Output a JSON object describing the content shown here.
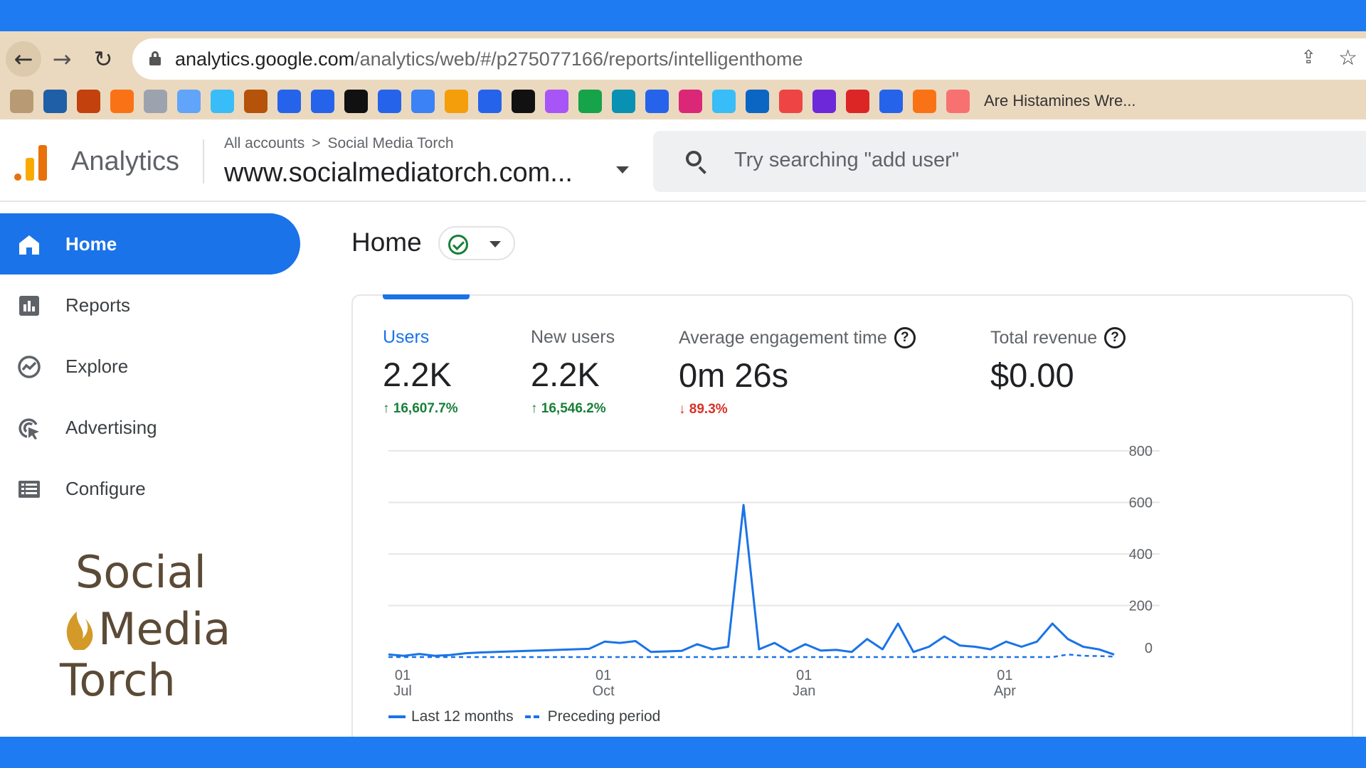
{
  "browser": {
    "url_host": "analytics.google.com",
    "url_path": "/analytics/web/#/p275077166/reports/intelligenthome",
    "bookmark_label": "Are Histamines Wre...",
    "bookmark_icons": [
      {
        "name": "bookmark-icon-1",
        "color": "#b89a74",
        "glyph": ""
      },
      {
        "name": "bookmark-icon-2",
        "color": "#1f5fa8",
        "glyph": ""
      },
      {
        "name": "bookmark-icon-3",
        "color": "#c2410c",
        "glyph": ""
      },
      {
        "name": "bookmark-icon-4",
        "color": "#f97316",
        "glyph": ""
      },
      {
        "name": "bookmark-icon-5",
        "color": "#9ca3af",
        "glyph": ""
      },
      {
        "name": "bookmark-icon-6",
        "color": "#60a5fa",
        "glyph": ""
      },
      {
        "name": "bookmark-icon-7",
        "color": "#38bdf8",
        "glyph": ""
      },
      {
        "name": "bookmark-icon-8",
        "color": "#b45309",
        "glyph": ""
      },
      {
        "name": "bookmark-icon-9",
        "color": "#2563eb",
        "glyph": ""
      },
      {
        "name": "bookmark-icon-10",
        "color": "#2563eb",
        "glyph": ""
      },
      {
        "name": "bookmark-icon-11",
        "color": "#111111",
        "glyph": ""
      },
      {
        "name": "bookmark-icon-12",
        "color": "#2563eb",
        "glyph": ""
      },
      {
        "name": "bookmark-icon-13",
        "color": "#3b82f6",
        "glyph": ""
      },
      {
        "name": "bookmark-icon-14",
        "color": "#f59e0b",
        "glyph": ""
      },
      {
        "name": "bookmark-icon-15",
        "color": "#2563eb",
        "glyph": ""
      },
      {
        "name": "bookmark-icon-16",
        "color": "#111111",
        "glyph": ""
      },
      {
        "name": "bookmark-icon-17",
        "color": "#a855f7",
        "glyph": ""
      },
      {
        "name": "bookmark-icon-18",
        "color": "#16a34a",
        "glyph": ""
      },
      {
        "name": "bookmark-icon-19",
        "color": "#0891b2",
        "glyph": ""
      },
      {
        "name": "bookmark-icon-20",
        "color": "#2563eb",
        "glyph": ""
      },
      {
        "name": "bookmark-icon-21",
        "color": "#db2777",
        "glyph": ""
      },
      {
        "name": "bookmark-icon-22",
        "color": "#38bdf8",
        "glyph": ""
      },
      {
        "name": "bookmark-icon-23",
        "color": "#0a66c2",
        "glyph": ""
      },
      {
        "name": "bookmark-icon-24",
        "color": "#ef4444",
        "glyph": ""
      },
      {
        "name": "bookmark-icon-25",
        "color": "#6d28d9",
        "glyph": ""
      },
      {
        "name": "bookmark-icon-26",
        "color": "#dc2626",
        "glyph": ""
      },
      {
        "name": "bookmark-icon-27",
        "color": "#2563eb",
        "glyph": ""
      },
      {
        "name": "bookmark-icon-28",
        "color": "#f97316",
        "glyph": ""
      },
      {
        "name": "bookmark-icon-29",
        "color": "#f87171",
        "glyph": ""
      }
    ]
  },
  "header": {
    "app_name": "Analytics",
    "breadcrumb_root": "All accounts",
    "breadcrumb_sep": ">",
    "breadcrumb_account": "Social Media Torch",
    "property": "www.socialmediatorch.com...",
    "search_placeholder": "Try searching \"add user\""
  },
  "sidebar": {
    "items": [
      {
        "label": "Home",
        "icon": "home-icon",
        "active": true
      },
      {
        "label": "Reports",
        "icon": "reports-icon",
        "active": false
      },
      {
        "label": "Explore",
        "icon": "explore-icon",
        "active": false
      },
      {
        "label": "Advertising",
        "icon": "advertising-icon",
        "active": false
      },
      {
        "label": "Configure",
        "icon": "configure-icon",
        "active": false
      }
    ],
    "brand_logo_text": [
      "Social",
      "Media",
      "Torch"
    ]
  },
  "main": {
    "title": "Home",
    "metrics": [
      {
        "label": "Users",
        "value": "2.2K",
        "delta": "16,607.7%",
        "direction": "up",
        "help": false,
        "selected": true
      },
      {
        "label": "New users",
        "value": "2.2K",
        "delta": "16,546.2%",
        "direction": "up",
        "help": false,
        "selected": false
      },
      {
        "label": "Average engagement time",
        "value": "0m 26s",
        "delta": "89.3%",
        "direction": "down",
        "help": true,
        "selected": false
      },
      {
        "label": "Total revenue",
        "value": "$0.00",
        "delta": "",
        "direction": "",
        "help": true,
        "selected": false
      }
    ],
    "legend": {
      "current": "Last 12 months",
      "previous": "Preceding period"
    }
  },
  "colors": {
    "accent": "#1a73e8",
    "frame": "#1f7bf2",
    "up": "#188038",
    "down": "#d93025",
    "browser": "#ebd9bf"
  },
  "chart_data": {
    "type": "line",
    "x_ticks": [
      {
        "day": "01",
        "month": "Jul",
        "index": 0
      },
      {
        "day": "01",
        "month": "Oct",
        "index": 13
      },
      {
        "day": "01",
        "month": "Jan",
        "index": 26
      },
      {
        "day": "01",
        "month": "Apr",
        "index": 39
      }
    ],
    "y_ticks": [
      0,
      200,
      400,
      600,
      800
    ],
    "ylim": [
      0,
      800
    ],
    "grid": true,
    "legend_position": "bottom-left",
    "series": [
      {
        "name": "Last 12 months",
        "style": "solid",
        "values": [
          10,
          5,
          12,
          5,
          8,
          15,
          18,
          20,
          22,
          24,
          26,
          28,
          30,
          32,
          60,
          55,
          62,
          20,
          22,
          24,
          50,
          30,
          40,
          590,
          30,
          55,
          20,
          50,
          25,
          28,
          20,
          70,
          30,
          130,
          20,
          40,
          80,
          45,
          40,
          30,
          60,
          40,
          60,
          130,
          70,
          40,
          30,
          10
        ]
      },
      {
        "name": "Preceding period",
        "style": "dashed",
        "values": [
          0,
          0,
          0,
          0,
          0,
          0,
          0,
          0,
          0,
          0,
          0,
          0,
          0,
          0,
          0,
          0,
          0,
          0,
          0,
          0,
          0,
          0,
          0,
          0,
          0,
          0,
          0,
          0,
          0,
          0,
          0,
          0,
          0,
          0,
          0,
          0,
          0,
          0,
          0,
          0,
          0,
          0,
          0,
          0,
          10,
          5,
          4,
          2
        ]
      }
    ]
  }
}
